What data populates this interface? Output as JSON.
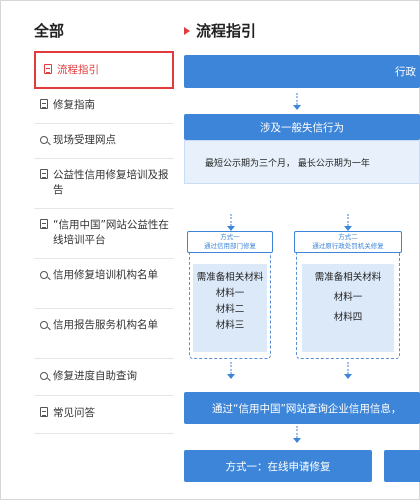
{
  "sidebar": {
    "title": "全部",
    "items": [
      {
        "label": "流程指引",
        "icon": "doc-icon"
      },
      {
        "label": "修复指南",
        "icon": "doc-icon"
      },
      {
        "label": "现场受理网点",
        "icon": "search-icon"
      },
      {
        "label": "公益性信用修复培训及报告",
        "icon": "doc-icon"
      },
      {
        "label": "“信用中国”网站公益性在线培训平台",
        "icon": "doc-icon"
      },
      {
        "label": "信用修复培训机构名单",
        "icon": "search-icon"
      },
      {
        "label": "信用报告服务机构名单",
        "icon": "search-icon"
      },
      {
        "label": "修复进度自助查询",
        "icon": "search-icon"
      },
      {
        "label": "常见问答",
        "icon": "doc-icon"
      }
    ]
  },
  "main": {
    "title": "流程指引",
    "top_bar": "行政",
    "section_header": "涉及一般失信行为",
    "publicity_text": "最短公示期为三个月， 最长公示期为一年",
    "method1": {
      "tag_line1": "方式一",
      "tag_line2": "通过信用部门修复",
      "materials_title": "需准备相关材料",
      "materials": [
        "材料一",
        "材料二",
        "材料三"
      ]
    },
    "method2": {
      "tag_line1": "方式二",
      "tag_line2": "通过原行政处罚机关修复",
      "materials_title": "需准备相关材料",
      "materials": [
        "材料一",
        "材料四"
      ]
    },
    "query_bar": "通过“信用中国”网站查询企业信用信息，",
    "online_bar": "方式一：在线申请修复"
  },
  "colors": {
    "accent": "#e23b3b",
    "primary": "#3d85d8",
    "light": "#e8f1fb"
  }
}
